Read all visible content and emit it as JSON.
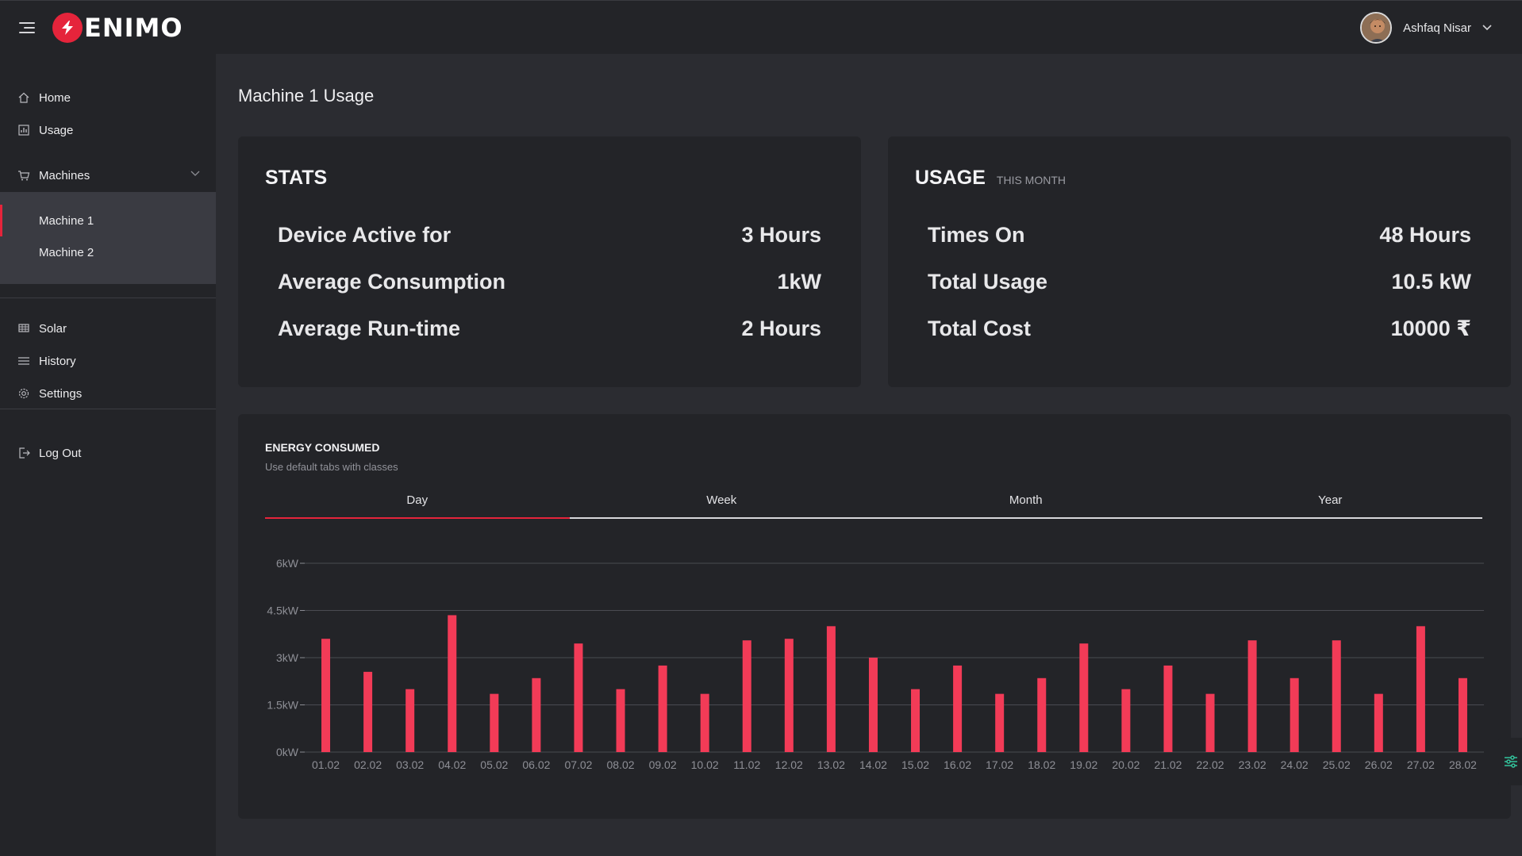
{
  "app": {
    "brand": "ENIMO",
    "user_name": "Ashfaq Nisar"
  },
  "sidebar": {
    "home": "Home",
    "usage": "Usage",
    "machines": "Machines",
    "machine_items": [
      "Machine 1",
      "Machine 2"
    ],
    "solar": "Solar",
    "history": "History",
    "settings": "Settings",
    "logout": "Log Out"
  },
  "page": {
    "title": "Machine 1 Usage"
  },
  "stats": {
    "title": "STATS",
    "rows": [
      {
        "label": "Device Active for",
        "value": "3 Hours"
      },
      {
        "label": "Average Consumption",
        "value": "1kW"
      },
      {
        "label": "Average Run-time",
        "value": "2 Hours"
      }
    ]
  },
  "usage": {
    "title": "USAGE",
    "subtitle": "THIS MONTH",
    "rows": [
      {
        "label": "Times On",
        "value": "48 Hours"
      },
      {
        "label": "Total Usage",
        "value": "10.5 kW"
      },
      {
        "label": "Total Cost",
        "value": "10000 ₹"
      }
    ]
  },
  "energy": {
    "title": "ENERGY CONSUMED",
    "subtitle": "Use default tabs with classes",
    "tabs": [
      "Day",
      "Week",
      "Month",
      "Year"
    ],
    "active_tab": "Day"
  },
  "colors": {
    "accent": "#e5243b",
    "bar": "#f23b57",
    "card": "#232428",
    "background": "#2b2c31"
  },
  "chart_data": {
    "type": "bar",
    "categories": [
      "01.02",
      "02.02",
      "03.02",
      "04.02",
      "05.02",
      "06.02",
      "07.02",
      "08.02",
      "09.02",
      "10.02",
      "11.02",
      "12.02",
      "13.02",
      "14.02",
      "15.02",
      "16.02",
      "17.02",
      "18.02",
      "19.02",
      "20.02",
      "21.02",
      "22.02",
      "23.02",
      "24.02",
      "25.02",
      "26.02",
      "27.02",
      "28.02"
    ],
    "values": [
      3.6,
      2.55,
      2.0,
      4.35,
      1.85,
      2.35,
      3.45,
      2.0,
      2.75,
      1.85,
      3.55,
      3.6,
      4.0,
      3.0,
      2.0,
      2.75,
      1.85,
      2.35,
      3.45,
      2.0,
      2.75,
      1.85,
      3.55,
      2.35,
      3.55,
      1.85,
      4.0,
      2.35
    ],
    "ytick_labels": [
      "0kW",
      "1.5kW",
      "3kW",
      "4.5kW",
      "6kW"
    ],
    "yticks": [
      0,
      1.5,
      3,
      4.5,
      6
    ],
    "ylim": [
      0,
      6
    ],
    "grid": true
  }
}
